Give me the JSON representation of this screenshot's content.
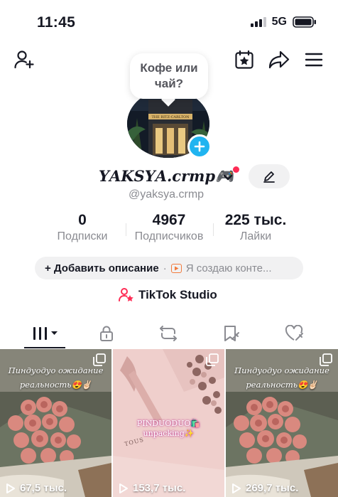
{
  "status_bar": {
    "time": "11:45",
    "network": "5G"
  },
  "profile": {
    "note": "Кофе или чай?",
    "name": "𝒀𝑨𝑲𝑺𝒀𝑨.crmp🎮",
    "handle": "@yaksya.crmp"
  },
  "stats": [
    {
      "value": "0",
      "label": "Подписки"
    },
    {
      "value": "4967",
      "label": "Подписчиков"
    },
    {
      "value": "225 тыс.",
      "label": "Лайки"
    }
  ],
  "bio": {
    "add_label": "+ Добавить описание",
    "separator": "·",
    "creator_label": "Я создаю конте..."
  },
  "studio": {
    "label": "TikTok Studio"
  },
  "videos": [
    {
      "caption": "Пиндуодуо ожидание реальность😍✌🏻",
      "views": "67,5 тыс."
    },
    {
      "caption": "PINDUODUO🛍️ unpacking✨",
      "brand": "TOUS",
      "views": "153,7 тыс."
    },
    {
      "caption": "Пиндуодуо ожидание реальность😍✌🏻",
      "views": "269,7 тыс."
    }
  ],
  "colors": {
    "accent_red": "#fe2c55",
    "plus_blue": "#20b4f0",
    "pill_bg": "#f1f1f2"
  },
  "icons": [
    "add-friend-icon",
    "calendar-star-icon",
    "share-icon",
    "menu-icon",
    "grid-icon",
    "lock-icon",
    "repost-icon",
    "favorites-icon",
    "liked-icon"
  ]
}
